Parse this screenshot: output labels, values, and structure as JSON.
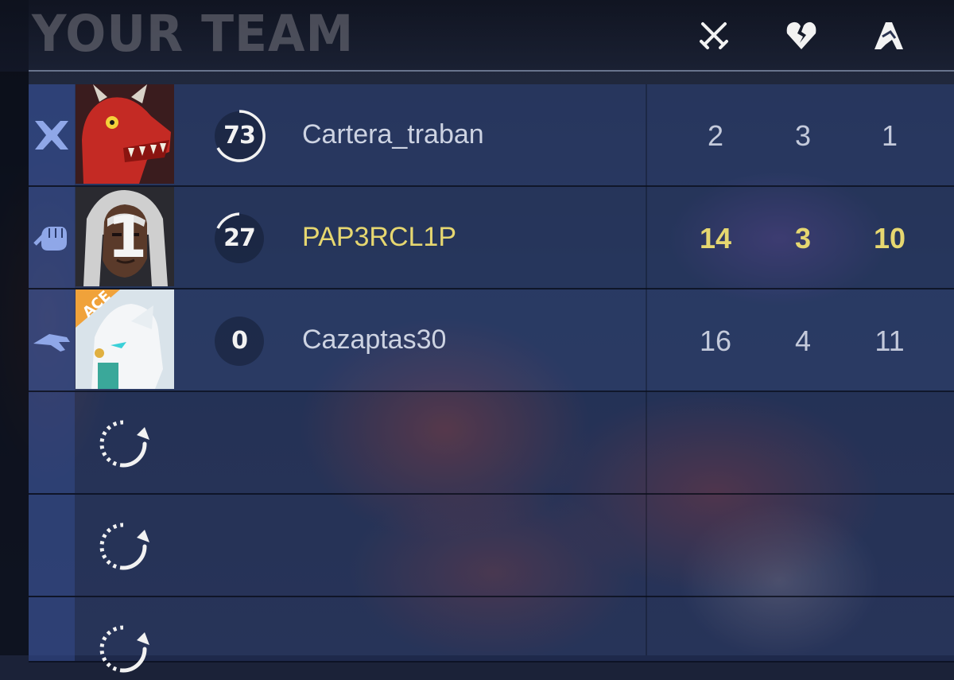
{
  "header": {
    "title": "YOUR TEAM",
    "columns": [
      {
        "icon": "crossed-swords-icon"
      },
      {
        "icon": "broken-heart-icon"
      },
      {
        "icon": "handshake-icon"
      }
    ]
  },
  "players": [
    {
      "role_icon": "vanguard-role-icon",
      "portrait": "red-dragon-hero-portrait",
      "level": "73",
      "name": "Cartera_traban",
      "kills": "2",
      "deaths": "3",
      "assists": "1",
      "is_self": false
    },
    {
      "role_icon": "duelist-role-icon",
      "portrait": "white-haired-hero-portrait",
      "portrait_number": "1",
      "level": "27",
      "name": "PAP3RCL1P",
      "kills": "14",
      "deaths": "3",
      "assists": "10",
      "is_self": true
    },
    {
      "role_icon": "strategist-role-icon",
      "portrait": "white-wolf-hero-portrait",
      "badge": "ACE",
      "level": "0",
      "name": "Cazaptas30",
      "kills": "16",
      "deaths": "4",
      "assists": "11",
      "is_self": false
    }
  ],
  "empty_slots": [
    {
      "icon": "loading-icon"
    },
    {
      "icon": "loading-icon"
    },
    {
      "icon": "loading-icon"
    }
  ],
  "colors": {
    "self_highlight": "#e6d770",
    "text": "#cdd3e2",
    "role_icon": "#8fa7e8"
  }
}
